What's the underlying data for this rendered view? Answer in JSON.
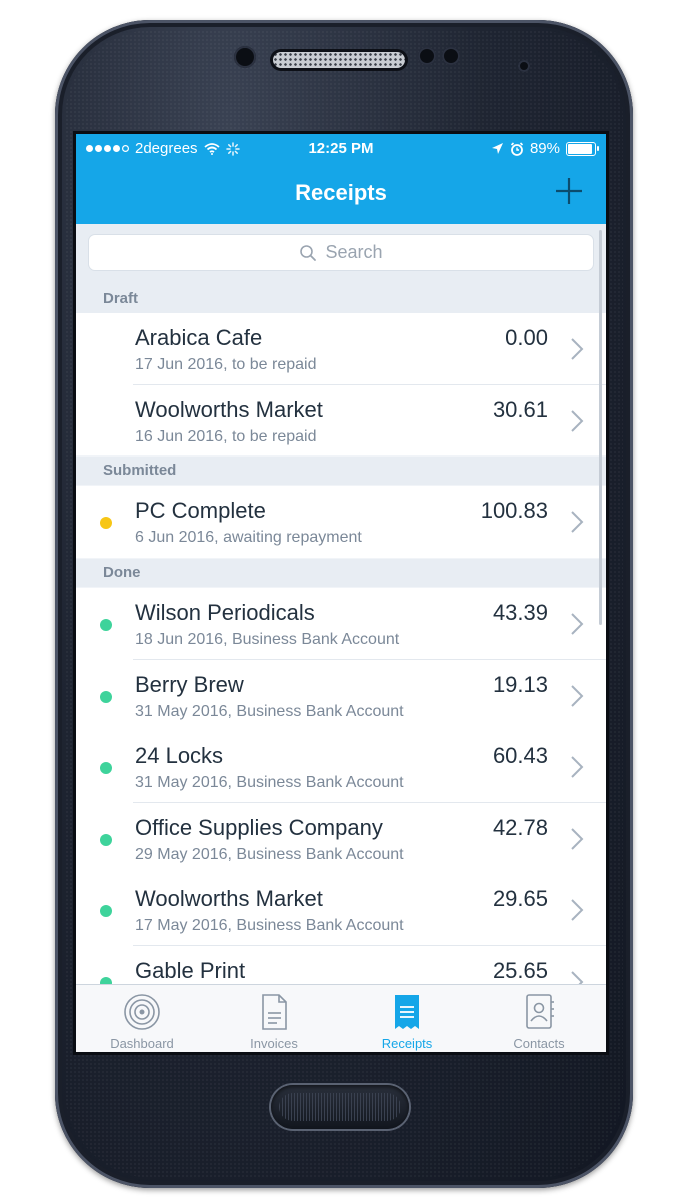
{
  "status_bar": {
    "carrier": "2degrees",
    "time": "12:25 PM",
    "battery": "89%"
  },
  "header": {
    "title": "Receipts",
    "add_icon": "plus-icon"
  },
  "search": {
    "placeholder": "Search"
  },
  "sections": {
    "draft": {
      "label": "Draft",
      "items": [
        {
          "name": "Arabica Cafe",
          "detail": "17 Jun 2016, to be repaid",
          "amount": "0.00"
        },
        {
          "name": "Woolworths Market",
          "detail": "16 Jun 2016, to be repaid",
          "amount": "30.61"
        }
      ]
    },
    "submitted": {
      "label": "Submitted",
      "status_color": "#f7c615",
      "items": [
        {
          "name": "PC Complete",
          "detail": "6 Jun 2016, awaiting repayment",
          "amount": "100.83"
        }
      ]
    },
    "done": {
      "label": "Done",
      "status_color": "#3ed39b",
      "items": [
        {
          "name": "Wilson Periodicals",
          "detail": "18 Jun 2016, Business Bank Account",
          "amount": "43.39"
        },
        {
          "name": "Berry Brew",
          "detail": "31 May 2016, Business Bank Account",
          "amount": "19.13"
        },
        {
          "name": "24 Locks",
          "detail": "31 May 2016, Business Bank Account",
          "amount": "60.43"
        },
        {
          "name": "Office Supplies Company",
          "detail": "29 May 2016, Business Bank Account",
          "amount": "42.78"
        },
        {
          "name": "Woolworths Market",
          "detail": "17 May 2016, Business Bank Account",
          "amount": "29.65"
        },
        {
          "name": "Gable Print",
          "detail": "",
          "amount": "25.65"
        }
      ]
    }
  },
  "tabs": [
    {
      "label": "Dashboard",
      "icon": "target-icon"
    },
    {
      "label": "Invoices",
      "icon": "document-icon"
    },
    {
      "label": "Receipts",
      "icon": "receipt-icon"
    },
    {
      "label": "Contacts",
      "icon": "contact-book-icon"
    }
  ],
  "colors": {
    "accent": "#15a6e8",
    "submitted": "#f7c615",
    "done": "#3ed39b"
  }
}
